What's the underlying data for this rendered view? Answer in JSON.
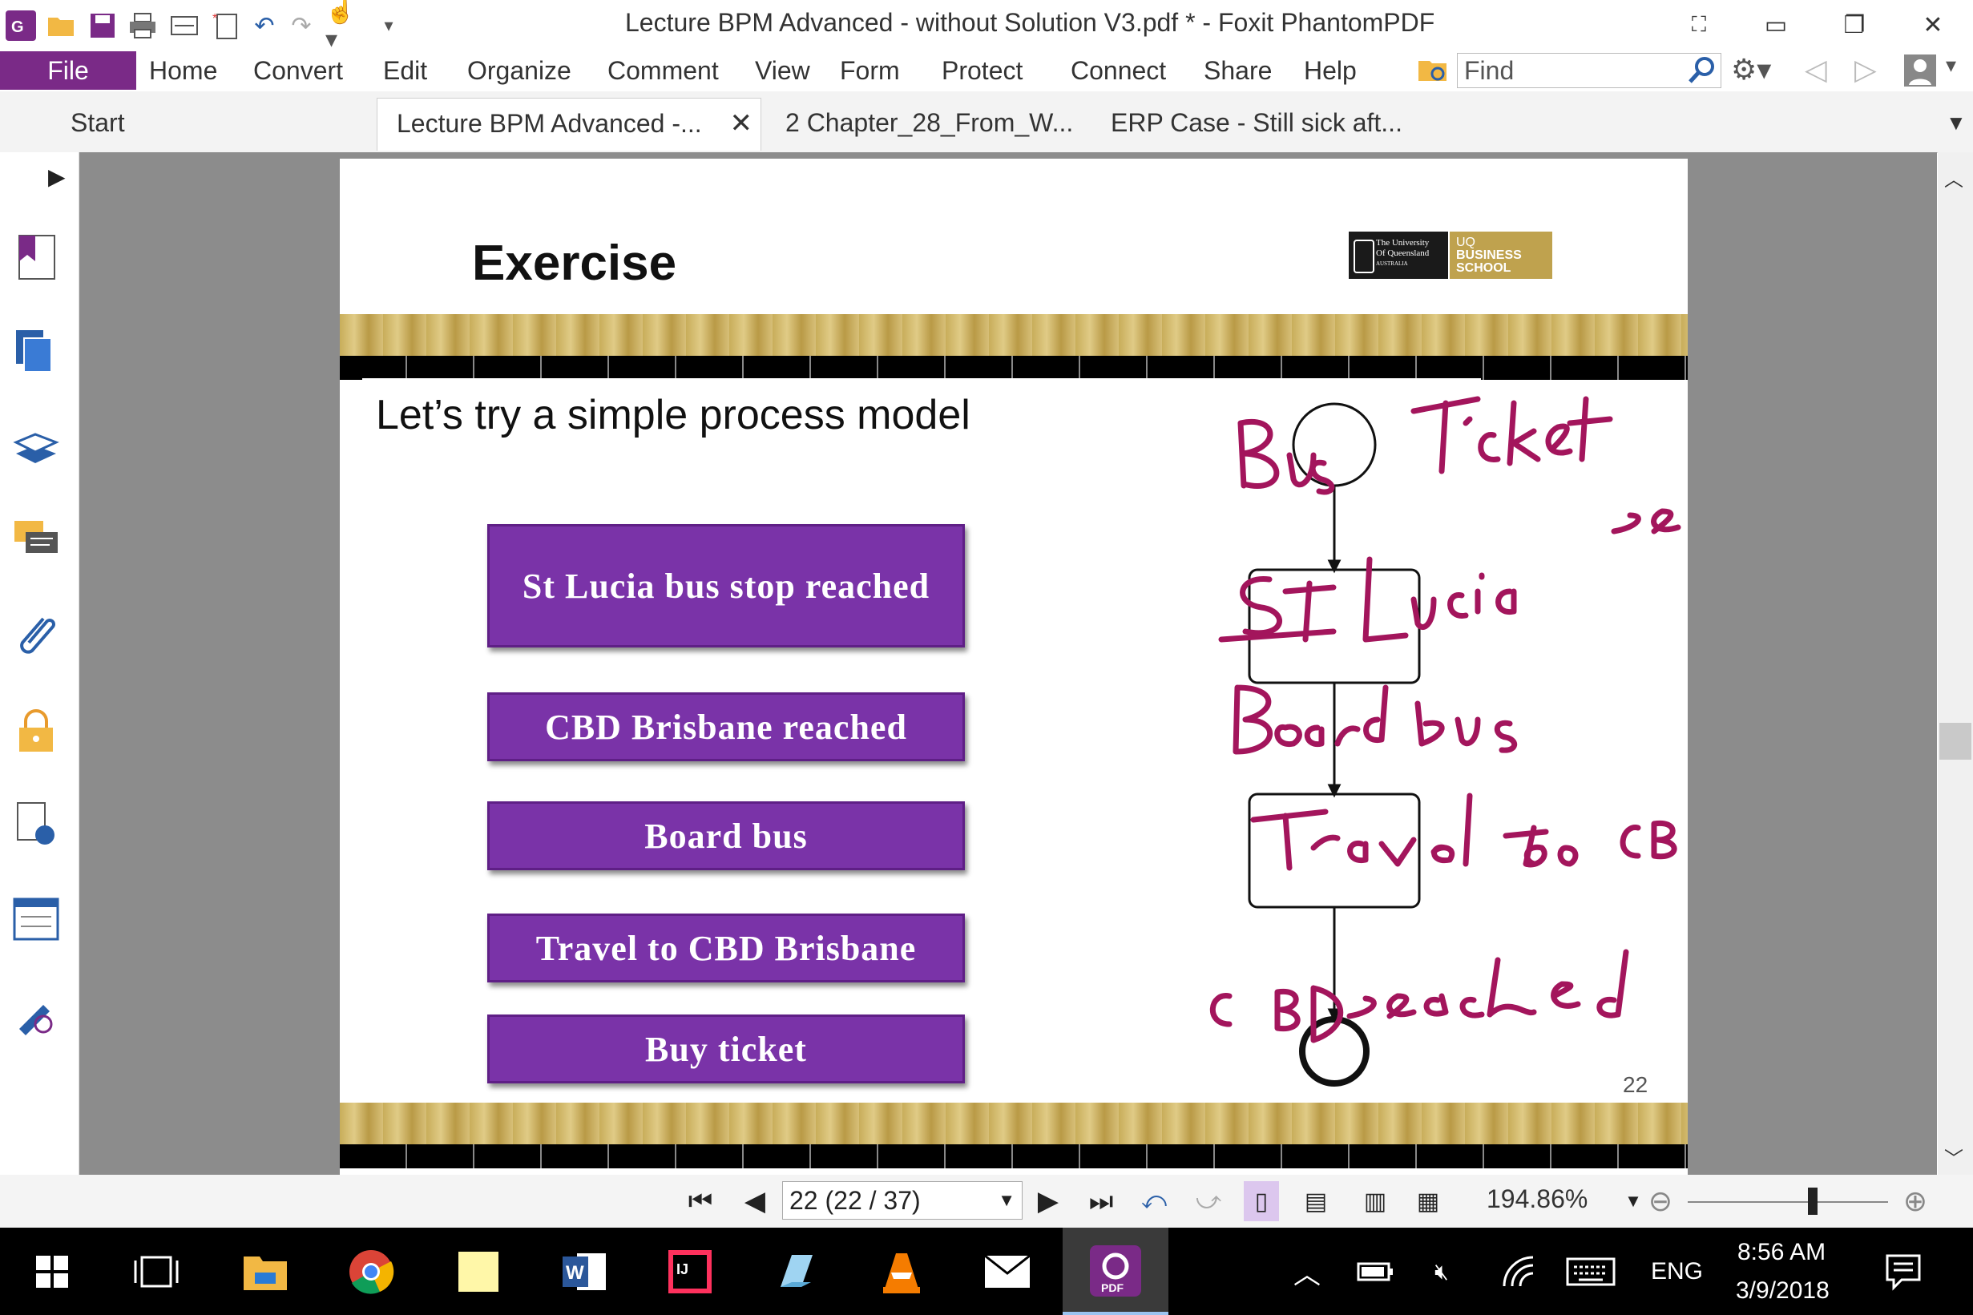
{
  "titlebar": {
    "title": "Lecture BPM Advanced - without Solution V3.pdf * - Foxit PhantomPDF",
    "quick_access_icons": [
      "foxit-logo-icon",
      "open-folder-icon",
      "save-icon",
      "print-icon",
      "scan-icon",
      "new-icon",
      "undo-icon",
      "redo-icon",
      "hand-tool-icon",
      "customize-dropdown-icon"
    ],
    "window_controls": [
      "fullscreen-icon",
      "ribbon-display-icon",
      "restore-icon",
      "close-icon"
    ]
  },
  "menu": {
    "file": "File",
    "items": [
      "Home",
      "Convert",
      "Edit",
      "Organize",
      "Comment",
      "View",
      "Form",
      "Protect",
      "Connect",
      "Share",
      "Help"
    ],
    "find_placeholder": "Find"
  },
  "tabs": [
    {
      "label": "Start"
    },
    {
      "label": "Lecture BPM Advanced -...",
      "active": true
    },
    {
      "label": "2 Chapter_28_From_W..."
    },
    {
      "label": "ERP Case - Still sick aft..."
    }
  ],
  "sidebar": [
    "expand-arrow-icon",
    "bookmark-icon",
    "pages-icon",
    "layers-icon",
    "comments-icon",
    "attachments-icon",
    "security-icon",
    "accessibility-icon",
    "fields-icon",
    "signature-icon"
  ],
  "slide": {
    "title": "Exercise",
    "logo": {
      "uq_line1": "The University",
      "uq_line2": "Of Queensland",
      "uq_line3": "AUSTRALIA",
      "bs_line1": "UQ",
      "bs_line2": "BUSINESS",
      "bs_line3": "SCHOOL"
    },
    "subtitle": "Let’s try a simple process model",
    "buttons": [
      "St Lucia bus stop reached",
      "CBD Brisbane reached",
      "Board bus",
      "Travel to CBD Brisbane",
      "Buy ticket"
    ],
    "page_number": "22",
    "ink_color": "#a3155c"
  },
  "status": {
    "page_select": "22 (22 / 37)",
    "zoom": "194.86%"
  },
  "taskbar": {
    "apps": [
      "windows-start-icon",
      "task-view-icon",
      "file-explorer-icon",
      "chrome-icon",
      "sticky-notes-icon",
      "word-icon",
      "intellij-icon",
      "paint-icon",
      "vlc-icon",
      "mail-icon",
      "foxit-pdf-icon"
    ],
    "tray_icons": [
      "show-hidden-icon",
      "battery-icon",
      "mute-icon",
      "wifi-icon",
      "keyboard-icon"
    ],
    "lang": "ENG",
    "time": "8:56 AM",
    "date": "3/9/2018"
  }
}
